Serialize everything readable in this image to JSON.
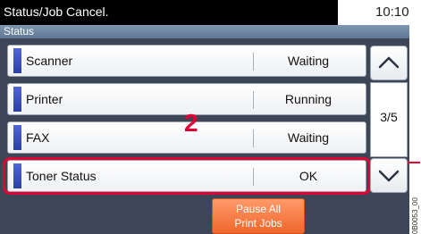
{
  "header": {
    "title": "Status/Job Cancel.",
    "time": "10:10"
  },
  "subheader": {
    "label": "Status"
  },
  "rows": [
    {
      "name": "Scanner",
      "state": "Waiting"
    },
    {
      "name": "Printer",
      "state": "Running"
    },
    {
      "name": "FAX",
      "state": "Waiting"
    },
    {
      "name": "Toner Status",
      "state": "OK"
    }
  ],
  "pager": {
    "page": "3/5",
    "up_icon": "chevron-up-icon",
    "down_icon": "chevron-down-icon"
  },
  "callout": {
    "number": "2",
    "color": "#e00033"
  },
  "bottom": {
    "pause_line1": "Pause All",
    "pause_line2": "Print Jobs"
  },
  "side_code": "0B0053_00",
  "colors": {
    "accent": "#3a50c8",
    "pause_button": "#f47a43",
    "panel": "#3c4656"
  }
}
